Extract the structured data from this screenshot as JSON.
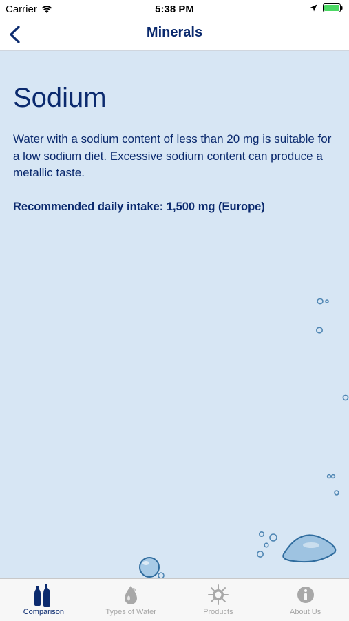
{
  "status_bar": {
    "carrier": "Carrier",
    "time": "5:38 PM"
  },
  "nav": {
    "title": "Minerals",
    "back_icon": "chevron-left-icon"
  },
  "content": {
    "heading": "Sodium",
    "description": "Water with a sodium content of less than 20 mg is suitable for a low sodium diet. Excessive sodium content can produce a metallic taste.",
    "recommended": "Recommended daily intake: 1,500 mg (Europe)"
  },
  "tabs": [
    {
      "label": "Comparison",
      "icon": "bottles-icon",
      "active": true
    },
    {
      "label": "Types of Water",
      "icon": "water-drop-icon",
      "active": false
    },
    {
      "label": "Products",
      "icon": "compass-icon",
      "active": false
    },
    {
      "label": "About Us",
      "icon": "info-icon",
      "active": false
    }
  ],
  "colors": {
    "primary": "#0b2a6e",
    "background": "#d7e6f4",
    "tab_inactive": "#a8a8a8"
  }
}
